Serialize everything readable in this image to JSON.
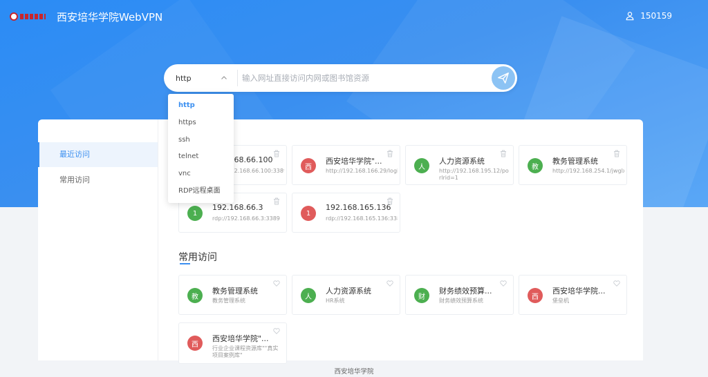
{
  "header": {
    "logo_icon": "school-logo",
    "title": "西安培华学院WebVPN",
    "user_icon": "user-icon",
    "username": "150159"
  },
  "search": {
    "protocol": "http",
    "placeholder": "输入网址直接访问内网或图书馆资源",
    "go_icon": "send-icon"
  },
  "dropdown": {
    "options": [
      "http",
      "https",
      "ssh",
      "telnet",
      "vnc",
      "RDP远程桌面"
    ],
    "selected": "http"
  },
  "sidebar": {
    "items": [
      {
        "label": "最近访问",
        "active": true
      },
      {
        "label": "常用访问",
        "active": false
      }
    ]
  },
  "recent": {
    "cards": [
      {
        "avatar": "",
        "name": "192.168.66.100",
        "url": "rdp://192.168.66.100:3389",
        "color": "#4caf50",
        "icon": "trash-icon"
      },
      {
        "avatar": "西",
        "name": "西安培华学院\"...",
        "url": "http://192.168.166.29/logi",
        "color": "#e05b5b",
        "icon": "trash-icon"
      },
      {
        "avatar": "人",
        "name": "人力资源系统",
        "url": "http://192.168.195.12/porlrid=1",
        "color": "#4caf50",
        "icon": "trash-icon"
      },
      {
        "avatar": "教",
        "name": "教务管理系统",
        "url": "http://192.168.254.1/jwglx",
        "color": "#4caf50",
        "icon": "trash-icon"
      },
      {
        "avatar": "1",
        "name": "192.168.66.3",
        "url": "rdp://192.168.66.3:3389",
        "color": "#4caf50",
        "icon": "trash-icon"
      },
      {
        "avatar": "1",
        "name": "192.168.165.136",
        "url": "rdp://192.168.165.136:338",
        "color": "#e05b5b",
        "icon": "trash-icon"
      }
    ]
  },
  "common": {
    "title": "常用访问",
    "cards": [
      {
        "avatar": "教",
        "name": "教务管理系统",
        "desc": "教务管理系统",
        "color": "#4caf50",
        "icon": "heart-icon"
      },
      {
        "avatar": "人",
        "name": "人力资源系统",
        "desc": "HR系统",
        "color": "#4caf50",
        "icon": "heart-icon"
      },
      {
        "avatar": "财",
        "name": "财务绩效预算...",
        "desc": "财务绩效预算系统",
        "color": "#4caf50",
        "icon": "heart-icon"
      },
      {
        "avatar": "西",
        "name": "西安培华学院...",
        "desc": "堡垒机",
        "color": "#e05b5b",
        "icon": "heart-icon"
      },
      {
        "avatar": "西",
        "name": "西安培华学院\"...",
        "desc": "行业企业课程资源库\"\"真实项目案例库\"",
        "color": "#e05b5b",
        "icon": "heart-icon"
      }
    ]
  },
  "footer": {
    "text": "西安培华学院"
  }
}
